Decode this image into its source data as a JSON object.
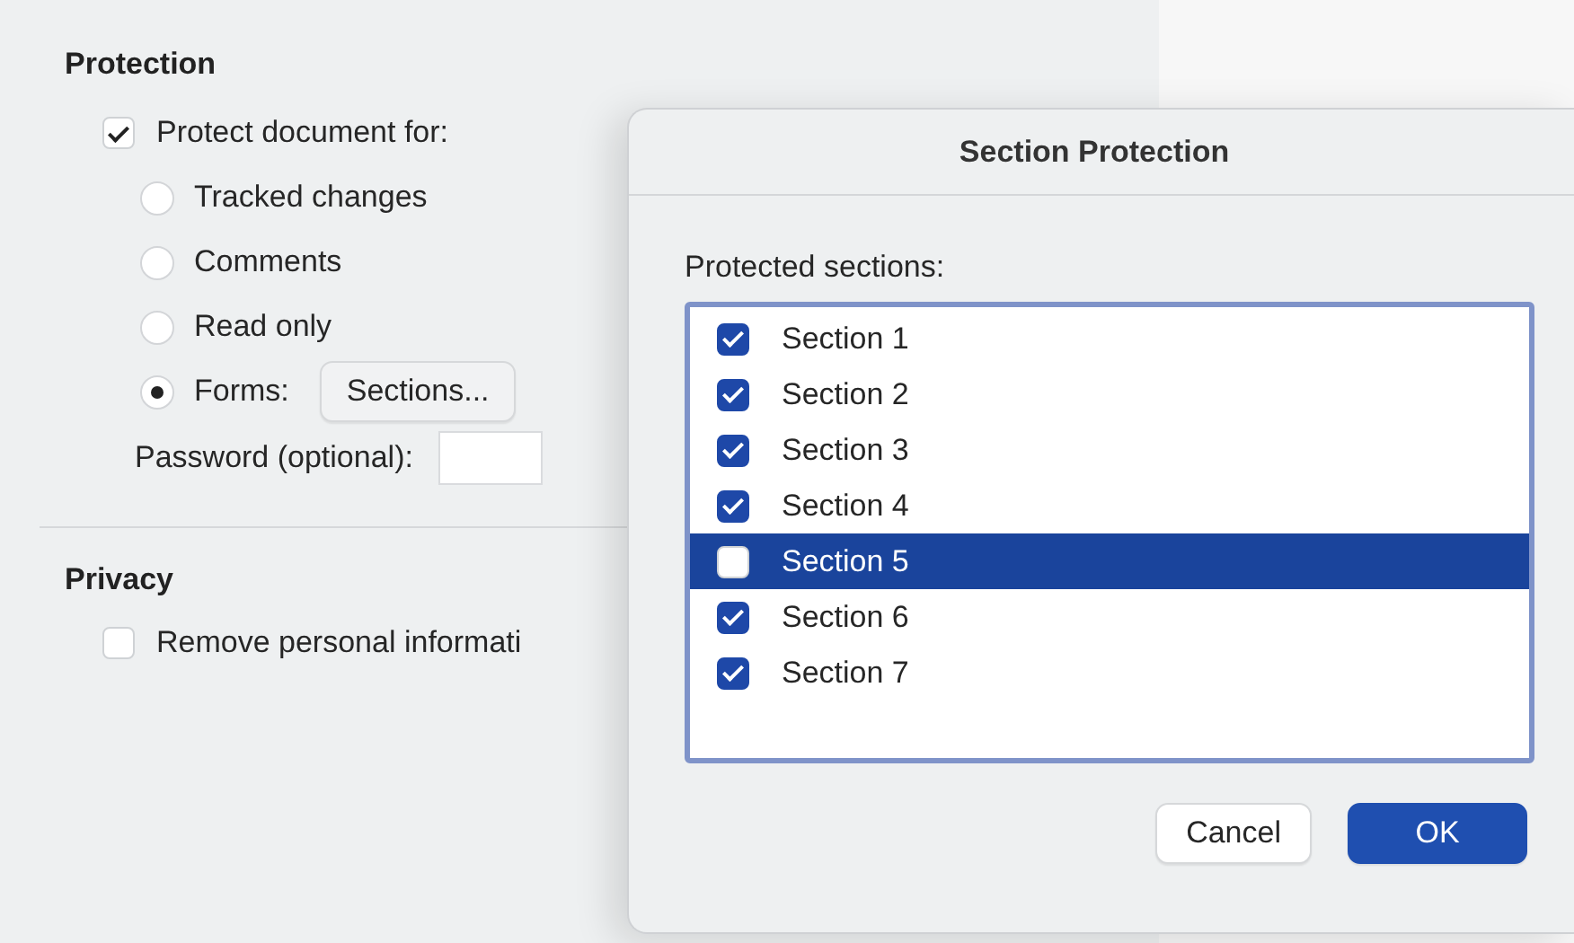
{
  "protection": {
    "heading": "Protection",
    "protect_document": {
      "label": "Protect document for:",
      "checked": true
    },
    "options": [
      {
        "label": "Tracked changes",
        "selected": false
      },
      {
        "label": "Comments",
        "selected": false
      },
      {
        "label": "Read only",
        "selected": false
      },
      {
        "label": "Forms:",
        "selected": true,
        "button": "Sections..."
      }
    ],
    "password": {
      "label": "Password (optional):"
    }
  },
  "privacy": {
    "heading": "Privacy",
    "remove_personal": {
      "label": "Remove personal informati",
      "checked": false
    }
  },
  "dialog": {
    "title": "Section Protection",
    "list_label": "Protected sections:",
    "sections": [
      {
        "label": "Section 1",
        "checked": true,
        "selected": false
      },
      {
        "label": "Section 2",
        "checked": true,
        "selected": false
      },
      {
        "label": "Section 3",
        "checked": true,
        "selected": false
      },
      {
        "label": "Section 4",
        "checked": true,
        "selected": false
      },
      {
        "label": "Section 5",
        "checked": false,
        "selected": true
      },
      {
        "label": "Section 6",
        "checked": true,
        "selected": false
      },
      {
        "label": "Section 7",
        "checked": true,
        "selected": false
      }
    ],
    "buttons": [
      {
        "label": "Cancel",
        "kind": "secondary"
      },
      {
        "label": "OK",
        "kind": "default"
      }
    ]
  }
}
